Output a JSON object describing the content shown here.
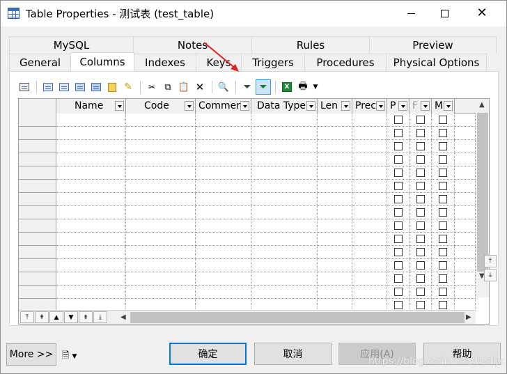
{
  "window": {
    "title": "Table Properties - 测试表 (test_table)"
  },
  "tabs": {
    "row1": [
      "MySQL",
      "Notes",
      "Rules",
      "Preview"
    ],
    "row2": [
      "General",
      "Columns",
      "Indexes",
      "Keys",
      "Triggers",
      "Procedures",
      "Physical Options"
    ],
    "active": "Columns"
  },
  "toolbar": {
    "icons": [
      "properties-icon",
      "insert-row-icon",
      "add-row-icon",
      "add-columns-icon",
      "add-domain-icon",
      "paste-attributes-icon",
      "customize-columns-icon",
      "cut-icon",
      "copy-icon",
      "paste-icon",
      "delete-icon",
      "find-icon",
      "filter-icon",
      "filter-columns-icon",
      "excel-export-icon",
      "print-icon",
      "dropdown-arrow"
    ]
  },
  "grid": {
    "columns": [
      "Name",
      "Code",
      "Comment",
      "Data Type",
      "Len",
      "Prec",
      "P",
      "F",
      "M"
    ],
    "row_count": 15
  },
  "buttons": {
    "more": "More >>",
    "ok": "确定",
    "cancel": "取消",
    "apply": "应用(A)",
    "help": "帮助"
  },
  "watermark": "https://blog.csdn.net/luzaijx",
  "colors": {
    "selection_border": "#3399ff",
    "default_button_border": "#0078d7",
    "annotation_arrow": "#e02020"
  }
}
